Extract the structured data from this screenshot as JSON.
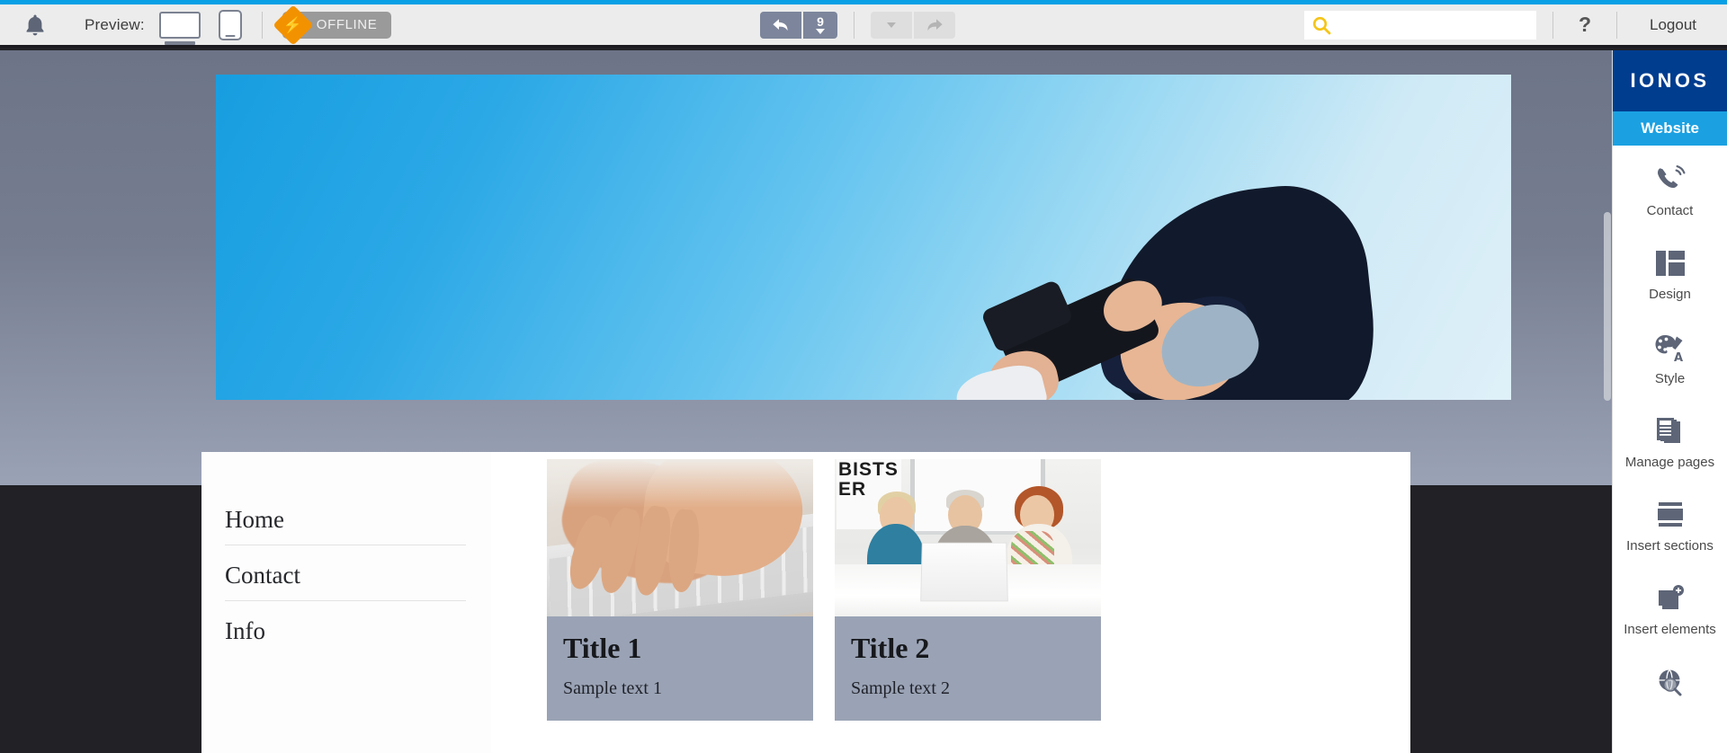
{
  "toolbar": {
    "bell_icon": "bell-icon",
    "preview_label": "Preview:",
    "desktop_icon": "desktop-monitor-icon",
    "mobile_icon": "mobile-phone-icon",
    "offline_badge": "OFFLINE",
    "offline_icon": "offline-diamond-icon",
    "undo_icon": "undo-arrow-icon",
    "undo_count": "9",
    "history_dropdown_icon": "chevron-down-icon",
    "redo_icon": "redo-arrow-icon",
    "search_icon": "search-icon",
    "search_value": "",
    "search_placeholder": "",
    "help_label": "?",
    "logout_label": "Logout"
  },
  "sidebar": {
    "brand": "IONOS",
    "active_tab": "Website",
    "items": [
      {
        "label": "Contact",
        "icon": "phone-icon"
      },
      {
        "label": "Design",
        "icon": "layout-blocks-icon"
      },
      {
        "label": "Style",
        "icon": "palette-brush-icon"
      },
      {
        "label": "Manage pages",
        "icon": "pages-stack-icon"
      },
      {
        "label": "Insert sections",
        "icon": "section-bars-icon"
      },
      {
        "label": "Insert elements",
        "icon": "elements-stack-icon"
      },
      {
        "label": "",
        "icon": "globe-search-icon"
      }
    ]
  },
  "page": {
    "hero_alt": "photographer-with-camera-against-blue-sky",
    "nav": [
      {
        "label": "Home"
      },
      {
        "label": "Contact"
      },
      {
        "label": "Info"
      }
    ],
    "cards": [
      {
        "title": "Title 1",
        "text": "Sample text 1",
        "image_alt": "hands-typing-on-laptop-keyboard"
      },
      {
        "title": "Title 2",
        "text": "Sample text 2",
        "image_alt": "three-colleagues-looking-at-laptop"
      }
    ]
  },
  "colors": {
    "accent_blue": "#1ba1e2",
    "brand_navy": "#003d8f",
    "offline_orange": "#f39200",
    "caption_grey": "#9aa3b5",
    "toolbar_grey": "#ececec",
    "stage_dark": "#212126"
  }
}
